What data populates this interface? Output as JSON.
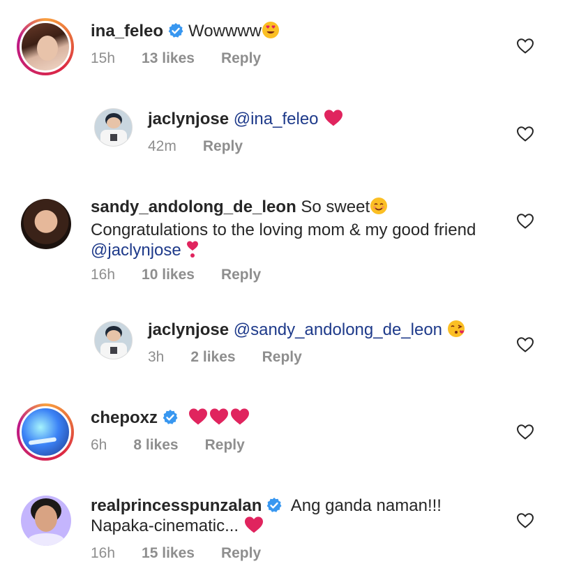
{
  "comments": [
    {
      "username": "ina_feleo",
      "verified": true,
      "text": "Wowwww",
      "emoji": "heart-eyes",
      "time": "15h",
      "likes": "13 likes",
      "reply": "Reply"
    },
    {
      "username": "jaclynjose",
      "mention": "@ina_feleo",
      "emoji": "red-heart",
      "time": "42m",
      "reply": "Reply"
    },
    {
      "username": "sandy_andolong_de_leon",
      "text_line1": "So sweet",
      "text_line2": "Congratulations to the loving mom & my good friend",
      "mention": "@jaclynjose",
      "time": "16h",
      "likes": "10 likes",
      "reply": "Reply"
    },
    {
      "username": "jaclynjose",
      "mention": "@sandy_andolong_de_leon",
      "emoji": "kiss-face",
      "time": "3h",
      "likes": "2 likes",
      "reply": "Reply"
    },
    {
      "username": "chepoxz",
      "verified": true,
      "emoji": "three-red-hearts",
      "time": "6h",
      "likes": "8 likes",
      "reply": "Reply"
    },
    {
      "username": "realprincesspunzalan",
      "verified": true,
      "text_line1": "Ang ganda naman!!!",
      "text_line2": "Napaka-cinematic...",
      "emoji": "red-heart",
      "time": "16h",
      "likes": "15 likes",
      "reply": "Reply"
    }
  ],
  "colors": {
    "verified": "#3897f0",
    "heart": "#e0245e",
    "meta": "#8e8e8e",
    "mention": "#1e3a8a"
  }
}
